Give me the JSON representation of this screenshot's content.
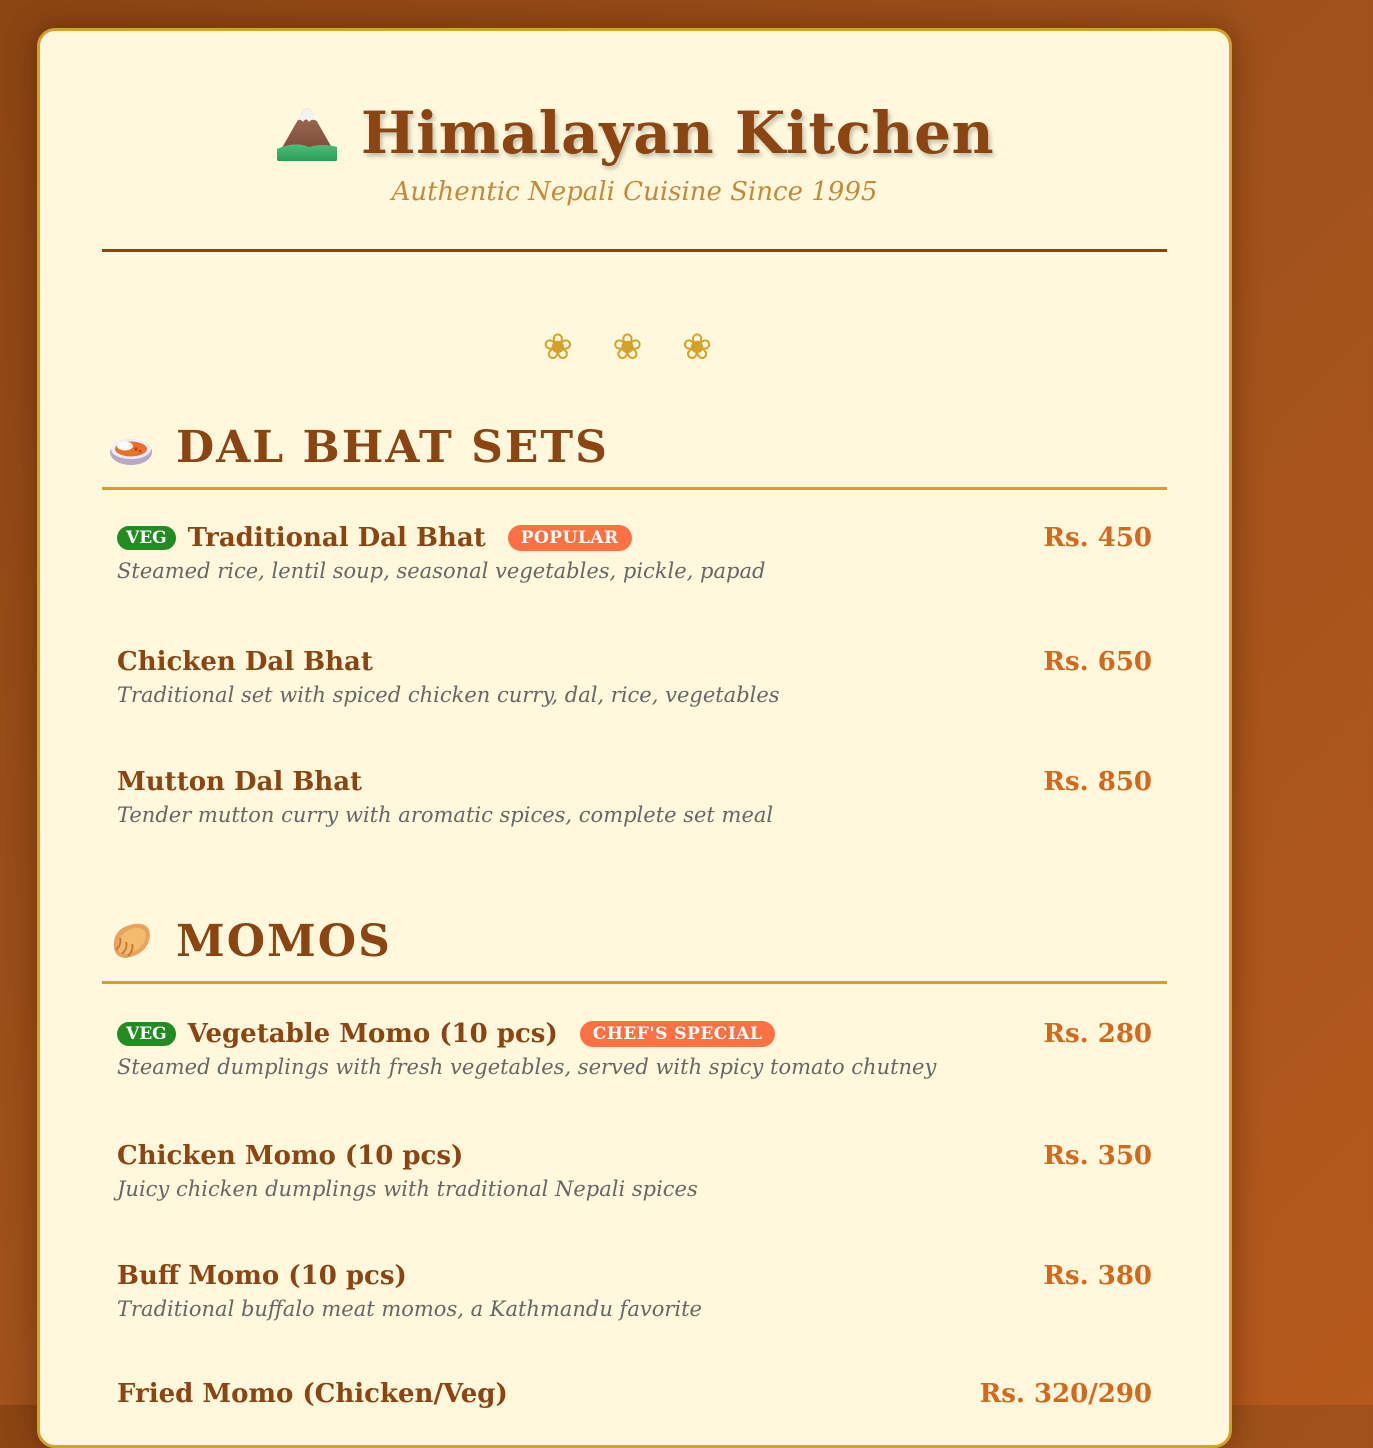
{
  "header": {
    "icon": "mountain-icon",
    "title": "Himalayan Kitchen",
    "subtitle": "Authentic Nepali Cuisine Since 1995"
  },
  "ornament": "❀ ❀ ❀",
  "colors": {
    "brown": "#8b4513",
    "gold": "#d4a22a",
    "cream": "#fff8dc",
    "veg_green": "#228b22",
    "tag_orange": "#ff7043",
    "price_orange": "#d2691e"
  },
  "sections": [
    {
      "icon": "curry-rice-icon",
      "title": "DAL BHAT SETS",
      "items": [
        {
          "veg": "VEG",
          "name": "Traditional Dal Bhat",
          "tag": "POPULAR",
          "price": "Rs. 450",
          "desc": "Steamed rice, lentil soup, seasonal vegetables, pickle, papad"
        },
        {
          "name": "Chicken Dal Bhat",
          "price": "Rs. 650",
          "desc": "Traditional set with spiced chicken curry, dal, rice, vegetables"
        },
        {
          "name": "Mutton Dal Bhat",
          "price": "Rs. 850",
          "desc": "Tender mutton curry with aromatic spices, complete set meal"
        }
      ]
    },
    {
      "icon": "dumpling-icon",
      "title": "MOMOS",
      "items": [
        {
          "veg": "VEG",
          "name": "Vegetable Momo (10 pcs)",
          "tag": "CHEF'S SPECIAL",
          "price": "Rs. 280",
          "desc": "Steamed dumplings with fresh vegetables, served with spicy tomato chutney"
        },
        {
          "name": "Chicken Momo (10 pcs)",
          "price": "Rs. 350",
          "desc": "Juicy chicken dumplings with traditional Nepali spices"
        },
        {
          "name": "Buff Momo (10 pcs)",
          "price": "Rs. 380",
          "desc": "Traditional buffalo meat momos, a Kathmandu favorite"
        },
        {
          "name": "Fried Momo (Chicken/Veg)",
          "price": "Rs. 320/290",
          "desc": ""
        }
      ]
    }
  ]
}
